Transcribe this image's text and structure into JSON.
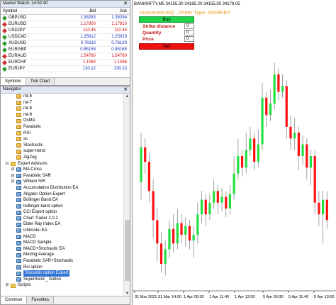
{
  "market_watch": {
    "title": "Market Watch: 14:52:40",
    "close_glyph": "✕",
    "columns": {
      "symbol": "Symbol",
      "bid": "Bid",
      "ask": "Ask"
    },
    "rows": [
      {
        "symbol": "GBPUSD",
        "bid": "1.38283",
        "ask": "1.38294",
        "dir": "up",
        "bid_color": "blue",
        "ask_color": "blue"
      },
      {
        "symbol": "EURUSD",
        "bid": "1.17800",
        "ask": "1.17810",
        "dir": "dn",
        "bid_color": "red",
        "ask_color": "red"
      },
      {
        "symbol": "USDJPY",
        "bid": "110.45",
        "ask": "110.45",
        "dir": "dn",
        "bid_color": "red",
        "ask_color": "red"
      },
      {
        "symbol": "USDCAD",
        "bid": "1.25612",
        "ask": "1.25629",
        "dir": "up",
        "bid_color": "blue",
        "ask_color": "blue"
      },
      {
        "symbol": "AUDUSD",
        "bid": "0.76110",
        "ask": "0.76120",
        "dir": "up",
        "bid_color": "blue",
        "ask_color": "blue"
      },
      {
        "symbol": "EURGBP",
        "bid": "0.85158",
        "ask": "0.85165",
        "dir": "up",
        "bid_color": "blue",
        "ask_color": "blue"
      },
      {
        "symbol": "EURAUD",
        "bid": "1.54760",
        "ask": "1.54780",
        "dir": "dn",
        "bid_color": "red",
        "ask_color": "red"
      },
      {
        "symbol": "EURCHF",
        "bid": "1.1084",
        "ask": "1.1086",
        "dir": "dn",
        "bid_color": "red",
        "ask_color": "red"
      },
      {
        "symbol": "EURJPY",
        "bid": "130.12",
        "ask": "130.13",
        "dir": "up",
        "bid_color": "blue",
        "ask_color": "blue"
      }
    ],
    "tabs": [
      "Symbols",
      "Tick Chart"
    ]
  },
  "navigator": {
    "title": "Navigator",
    "close_glyph": "✕",
    "items": [
      {
        "label": "mt-6",
        "level": 2,
        "kind": "ind"
      },
      {
        "label": "mt-7",
        "level": 2,
        "kind": "ind"
      },
      {
        "label": "mt-8",
        "level": 2,
        "kind": "ind"
      },
      {
        "label": "mt-9",
        "level": 2,
        "kind": "ind"
      },
      {
        "label": "OsMA",
        "level": 2,
        "kind": "ind"
      },
      {
        "label": "Parabolic",
        "level": 2,
        "kind": "ind"
      },
      {
        "label": "RSI",
        "level": 2,
        "kind": "ind"
      },
      {
        "label": "sc",
        "level": 2,
        "kind": "ind"
      },
      {
        "label": "Stochastic",
        "level": 2,
        "kind": "ind"
      },
      {
        "label": "super-trend",
        "level": 2,
        "kind": "ind"
      },
      {
        "label": "ZigZag",
        "level": 2,
        "kind": "ind"
      },
      {
        "label": "Expert Advisors",
        "level": 0,
        "kind": "fold",
        "toggle": "⊟"
      },
      {
        "label": "MA Cross",
        "level": 1,
        "kind": "ea",
        "toggle": "⊞"
      },
      {
        "label": "Parabolic SAR",
        "level": 1,
        "kind": "ea",
        "toggle": "⊞"
      },
      {
        "label": "William %R",
        "level": 1,
        "kind": "ea",
        "toggle": "⊞"
      },
      {
        "label": "Accumulation Distribution EA",
        "level": 2,
        "kind": "ea"
      },
      {
        "label": "Aligator Option Expert",
        "level": 2,
        "kind": "ea"
      },
      {
        "label": "Bollinger Band EA",
        "level": 2,
        "kind": "ea"
      },
      {
        "label": "bollinger band option",
        "level": 2,
        "kind": "ea"
      },
      {
        "label": "CCI Expert option",
        "level": 2,
        "kind": "ea"
      },
      {
        "label": "Chart Trader 2.0.1",
        "level": 2,
        "kind": "ea"
      },
      {
        "label": "Elder Ray Index EA",
        "level": 2,
        "kind": "ea"
      },
      {
        "label": "Ichimoku EA",
        "level": 2,
        "kind": "ea"
      },
      {
        "label": "MACD",
        "level": 2,
        "kind": "ea"
      },
      {
        "label": "MACD Sample",
        "level": 2,
        "kind": "ea"
      },
      {
        "label": "MACD+Stochastic EA",
        "level": 2,
        "kind": "ea"
      },
      {
        "label": "Moving Average",
        "level": 2,
        "kind": "ea"
      },
      {
        "label": "Parabolic SAR+Stochastic",
        "level": 2,
        "kind": "ea"
      },
      {
        "label": "Rsi option",
        "level": 2,
        "kind": "ea"
      },
      {
        "label": "Stocastic option Expert",
        "level": 2,
        "kind": "ea",
        "selected": true
      },
      {
        "label": "Supertrend _ button",
        "level": 2,
        "kind": "ea"
      },
      {
        "label": "Scripts",
        "level": 0,
        "kind": "fold",
        "toggle": "⊞"
      }
    ],
    "tabs": [
      "Common",
      "Favorites"
    ]
  },
  "chart_window": {
    "caption": "BANKNIFTY,M5  34155.30 34185.20 34155.30 34179.05",
    "order_panel": {
      "title": "Instrument-EQ , Order Type -MARKET",
      "buy_label": "Buy",
      "fields": [
        {
          "label": "Strike distance",
          "value": "0"
        },
        {
          "label": "Quantity",
          "value": "0"
        },
        {
          "label": "Price",
          "value": "0"
        }
      ],
      "sell_label": "Sell"
    },
    "colors": {
      "bull": "#22e040",
      "bear": "#ff1010",
      "wick": "#8a8a8a"
    },
    "chart_data": {
      "type": "candlestick",
      "x_tick_labels": [
        "31 Mar 2021",
        "31 Mar 14:00",
        "1 Apr 09:30",
        "1 Apr 11:40",
        "1 Apr 13:50",
        "5 Apr 09:30",
        "5 Apr 11:40",
        "5 Apr 13:50"
      ],
      "candles": [
        {
          "o": 51,
          "c": 63,
          "h": 68,
          "l": 45
        },
        {
          "o": 63,
          "c": 58,
          "h": 66,
          "l": 54
        },
        {
          "o": 58,
          "c": 48,
          "h": 61,
          "l": 44
        },
        {
          "o": 48,
          "c": 38,
          "h": 52,
          "l": 32
        },
        {
          "o": 38,
          "c": 30,
          "h": 42,
          "l": 24
        },
        {
          "o": 30,
          "c": 23,
          "h": 34,
          "l": 20
        },
        {
          "o": 23,
          "c": 28,
          "h": 31,
          "l": 19
        },
        {
          "o": 28,
          "c": 35,
          "h": 38,
          "l": 25
        },
        {
          "o": 35,
          "c": 30,
          "h": 40,
          "l": 27
        },
        {
          "o": 30,
          "c": 37,
          "h": 42,
          "l": 28
        },
        {
          "o": 37,
          "c": 33,
          "h": 40,
          "l": 30
        },
        {
          "o": 33,
          "c": 36,
          "h": 39,
          "l": 29
        },
        {
          "o": 36,
          "c": 31,
          "h": 38,
          "l": 28
        },
        {
          "o": 31,
          "c": 33,
          "h": 36,
          "l": 25
        },
        {
          "o": 33,
          "c": 40,
          "h": 44,
          "l": 30
        },
        {
          "o": 40,
          "c": 45,
          "h": 48,
          "l": 37
        },
        {
          "o": 45,
          "c": 40,
          "h": 47,
          "l": 36
        },
        {
          "o": 40,
          "c": 44,
          "h": 47,
          "l": 38
        },
        {
          "o": 44,
          "c": 48,
          "h": 52,
          "l": 42
        },
        {
          "o": 48,
          "c": 44,
          "h": 50,
          "l": 40
        },
        {
          "o": 44,
          "c": 46,
          "h": 49,
          "l": 41
        },
        {
          "o": 46,
          "c": 42,
          "h": 48,
          "l": 39
        },
        {
          "o": 42,
          "c": 47,
          "h": 50,
          "l": 40
        },
        {
          "o": 47,
          "c": 54,
          "h": 60,
          "l": 45
        },
        {
          "o": 54,
          "c": 60,
          "h": 66,
          "l": 52
        },
        {
          "o": 60,
          "c": 56,
          "h": 62,
          "l": 53
        },
        {
          "o": 56,
          "c": 62,
          "h": 68,
          "l": 54
        },
        {
          "o": 62,
          "c": 66,
          "h": 70,
          "l": 60
        },
        {
          "o": 66,
          "c": 58,
          "h": 68,
          "l": 55
        },
        {
          "o": 58,
          "c": 64,
          "h": 69,
          "l": 56
        },
        {
          "o": 64,
          "c": 80,
          "h": 85,
          "l": 62
        },
        {
          "o": 80,
          "c": 74,
          "h": 82,
          "l": 70
        },
        {
          "o": 74,
          "c": 78,
          "h": 83,
          "l": 72
        },
        {
          "o": 78,
          "c": 88,
          "h": 92,
          "l": 76
        },
        {
          "o": 88,
          "c": 82,
          "h": 90,
          "l": 79
        },
        {
          "o": 82,
          "c": 84,
          "h": 88,
          "l": 80
        },
        {
          "o": 84,
          "c": 70,
          "h": 86,
          "l": 66
        },
        {
          "o": 70,
          "c": 66,
          "h": 74,
          "l": 62
        },
        {
          "o": 66,
          "c": 68,
          "h": 73,
          "l": 62
        },
        {
          "o": 68,
          "c": 60,
          "h": 70,
          "l": 55
        },
        {
          "o": 60,
          "c": 64,
          "h": 67,
          "l": 57
        },
        {
          "o": 64,
          "c": 56,
          "h": 66,
          "l": 52
        },
        {
          "o": 56,
          "c": 60,
          "h": 62,
          "l": 50
        },
        {
          "o": 60,
          "c": 44,
          "h": 62,
          "l": 40
        },
        {
          "o": 44,
          "c": 40,
          "h": 48,
          "l": 36
        },
        {
          "o": 40,
          "c": 45,
          "h": 48,
          "l": 30
        },
        {
          "o": 45,
          "c": 38,
          "h": 48,
          "l": 35
        }
      ]
    }
  }
}
